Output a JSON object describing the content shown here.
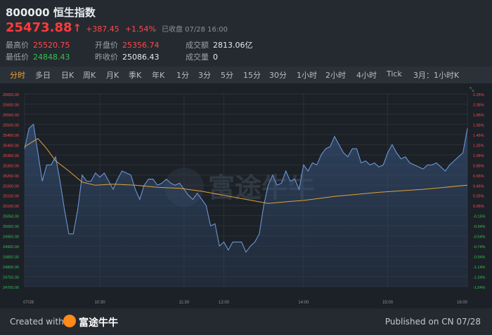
{
  "header": {
    "title": "800000 恒生指数",
    "price": "25473.88",
    "change": "+387.45",
    "change_pct": "+1.54%",
    "status": "已收盘 07/28 16:00"
  },
  "stats": [
    {
      "label": "最高价",
      "value": "25520.75",
      "color": "red"
    },
    {
      "label": "开盘价",
      "value": "25356.74",
      "color": "red"
    },
    {
      "label": "成交额",
      "value": "2813.06亿",
      "color": "white"
    },
    {
      "label": "最低价",
      "value": "24848.43",
      "color": "green"
    },
    {
      "label": "昨收价",
      "value": "25086.43",
      "color": "white"
    },
    {
      "label": "成交量",
      "value": "0",
      "color": "white"
    }
  ],
  "tabs": [
    "分时",
    "多日",
    "日K",
    "周K",
    "月K",
    "季K",
    "年K",
    "1分",
    "3分",
    "5分",
    "15分",
    "30分",
    "1小时",
    "2小时",
    "4小时",
    "Tick",
    "3月：1小时K"
  ],
  "active_tab": 0,
  "watermark": "富途牛牛",
  "footer": {
    "created": "Created with",
    "logo": "富途牛牛",
    "published": "Published on CN 07/28"
  },
  "colors": {
    "up": "#ff4a4a",
    "down": "#32c24d",
    "line": "#6b95d4",
    "avg": "#e0a23a",
    "active_tab": "#f0a030"
  },
  "chart_data": {
    "type": "line",
    "prev_close": 25086.43,
    "ylim": [
      24700,
      25650
    ],
    "y_ticks": [
      "25650.00",
      "25600.00",
      "25550.00",
      "25500.00",
      "25450.00",
      "25400.00",
      "25350.00",
      "25300.00",
      "25250.00",
      "25200.00",
      "25150.00",
      "25100.00",
      "25050.00",
      "25000.00",
      "24950.00",
      "24900.00",
      "24850.00",
      "24800.00",
      "24750.00",
      "24700.00"
    ],
    "pct_ticks": [
      "2.25%",
      "2.05%",
      "1.85%",
      "1.65%",
      "1.45%",
      "1.25%",
      "1.05%",
      "0.85%",
      "0.65%",
      "0.45%",
      "0.25%",
      "0.05%",
      "-0.15%",
      "-0.34%",
      "-0.54%",
      "-0.74%",
      "-0.94%",
      "-1.14%",
      "-1.34%",
      "-1.54%"
    ],
    "x_labels": [
      "07/28",
      "10:30",
      "11:30",
      "12:00",
      "14:00",
      "15:00",
      "16:00"
    ],
    "x_label_pos": [
      0,
      17,
      36,
      45,
      63,
      82,
      100
    ],
    "x_axis_max": 100,
    "series": [
      {
        "values_x": [
          0,
          1,
          2,
          3,
          4,
          5,
          6,
          7,
          8,
          9,
          10,
          11,
          12,
          13,
          14,
          15,
          16,
          17,
          18,
          19,
          20,
          21,
          22,
          23,
          24,
          25,
          26,
          27,
          28,
          29,
          30,
          31,
          32,
          33,
          34,
          35,
          36,
          37,
          38,
          39,
          40,
          41,
          42,
          43,
          44,
          45,
          46,
          47,
          48,
          49,
          50,
          51,
          52,
          53,
          54,
          55,
          56,
          57,
          58,
          59,
          60,
          61,
          62,
          63,
          64,
          65,
          66,
          67,
          68,
          69,
          70,
          71,
          72,
          73,
          74,
          75,
          76,
          77,
          78,
          79,
          80,
          81,
          82,
          83,
          84,
          85,
          86,
          87,
          88,
          89,
          90,
          91,
          92,
          93,
          94,
          95,
          96,
          97,
          98,
          99,
          100
        ],
        "values_y": [
          25380,
          25480,
          25500,
          25360,
          25220,
          25300,
          25300,
          25340,
          25220,
          25080,
          24960,
          24960,
          25080,
          25250,
          25220,
          25220,
          25260,
          25240,
          25260,
          25220,
          25180,
          25230,
          25270,
          25260,
          25250,
          25180,
          25130,
          25200,
          25230,
          25230,
          25200,
          25210,
          25230,
          25210,
          25200,
          25210,
          25180,
          25150,
          25130,
          25160,
          25130,
          25100,
          25000,
          25010,
          24900,
          24920,
          24880,
          24920,
          24920,
          24920,
          24870,
          24900,
          24920,
          24960,
          25100,
          25200,
          25250,
          25200,
          25210,
          25270,
          25220,
          25230,
          25180,
          25300,
          25270,
          25310,
          25300,
          25350,
          25380,
          25390,
          25440,
          25400,
          25360,
          25340,
          25380,
          25380,
          25310,
          25320,
          25300,
          25310,
          25290,
          25300,
          25360,
          25400,
          25360,
          25330,
          25340,
          25310,
          25300,
          25290,
          25280,
          25300,
          25300,
          25310,
          25290,
          25270,
          25300,
          25320,
          25340,
          25360,
          25480
        ]
      },
      {
        "values_x": [
          0,
          3,
          5,
          7,
          10,
          13,
          16,
          20,
          25,
          30,
          35,
          40,
          45,
          50,
          55,
          60,
          63,
          70,
          80,
          90,
          100
        ],
        "values_y": [
          25390,
          25430,
          25380,
          25320,
          25270,
          25215,
          25200,
          25205,
          25200,
          25190,
          25185,
          25170,
          25150,
          25130,
          25110,
          25120,
          25125,
          25145,
          25165,
          25180,
          25200
        ]
      }
    ]
  }
}
